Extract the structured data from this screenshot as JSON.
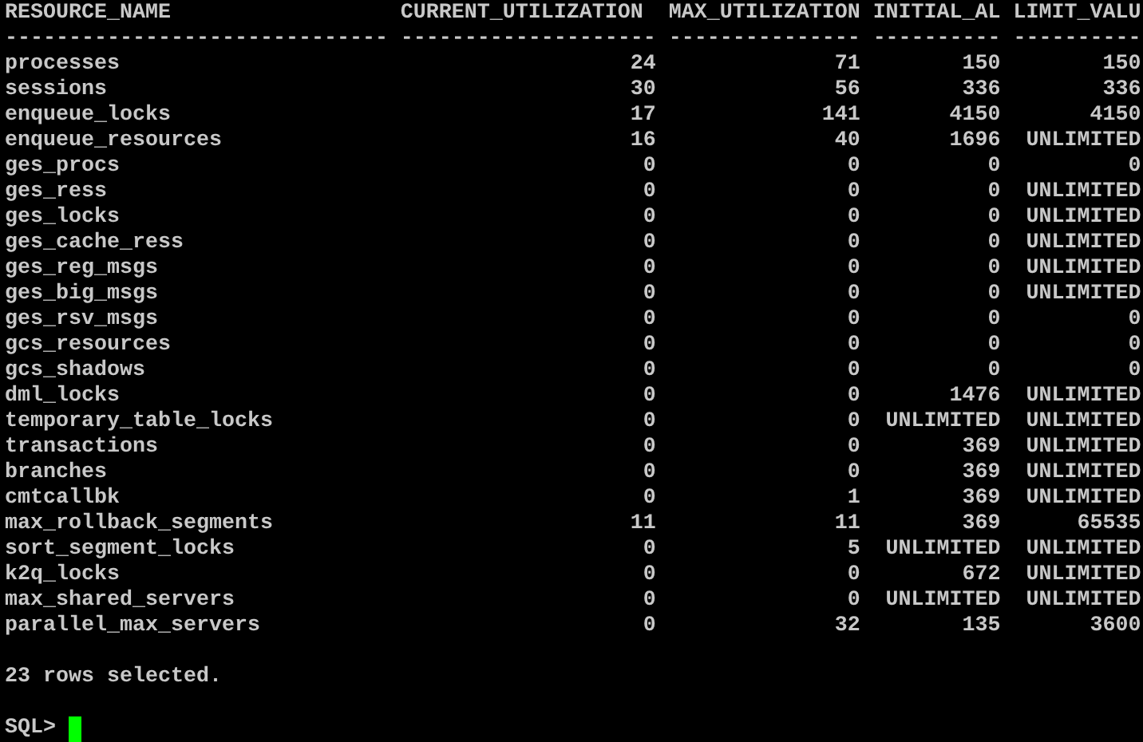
{
  "table": {
    "columns": [
      "RESOURCE_NAME",
      "CURRENT_UTILIZATION",
      "MAX_UTILIZATION",
      "INITIAL_AL",
      "LIMIT_VALU"
    ],
    "separators": [
      "------------------------------",
      "--------------------",
      "---------------",
      "----------",
      "----------"
    ],
    "rows": [
      [
        "processes",
        "24",
        "71",
        "150",
        "150"
      ],
      [
        "sessions",
        "30",
        "56",
        "336",
        "336"
      ],
      [
        "enqueue_locks",
        "17",
        "141",
        "4150",
        "4150"
      ],
      [
        "enqueue_resources",
        "16",
        "40",
        "1696",
        "UNLIMITED"
      ],
      [
        "ges_procs",
        "0",
        "0",
        "0",
        "0"
      ],
      [
        "ges_ress",
        "0",
        "0",
        "0",
        "UNLIMITED"
      ],
      [
        "ges_locks",
        "0",
        "0",
        "0",
        "UNLIMITED"
      ],
      [
        "ges_cache_ress",
        "0",
        "0",
        "0",
        "UNLIMITED"
      ],
      [
        "ges_reg_msgs",
        "0",
        "0",
        "0",
        "UNLIMITED"
      ],
      [
        "ges_big_msgs",
        "0",
        "0",
        "0",
        "UNLIMITED"
      ],
      [
        "ges_rsv_msgs",
        "0",
        "0",
        "0",
        "0"
      ],
      [
        "gcs_resources",
        "0",
        "0",
        "0",
        "0"
      ],
      [
        "gcs_shadows",
        "0",
        "0",
        "0",
        "0"
      ],
      [
        "dml_locks",
        "0",
        "0",
        "1476",
        "UNLIMITED"
      ],
      [
        "temporary_table_locks",
        "0",
        "0",
        "UNLIMITED",
        "UNLIMITED"
      ],
      [
        "transactions",
        "0",
        "0",
        "369",
        "UNLIMITED"
      ],
      [
        "branches",
        "0",
        "0",
        "369",
        "UNLIMITED"
      ],
      [
        "cmtcallbk",
        "0",
        "1",
        "369",
        "UNLIMITED"
      ],
      [
        "max_rollback_segments",
        "11",
        "11",
        "369",
        "65535"
      ],
      [
        "sort_segment_locks",
        "0",
        "5",
        "UNLIMITED",
        "UNLIMITED"
      ],
      [
        "k2q_locks",
        "0",
        "0",
        "672",
        "UNLIMITED"
      ],
      [
        "max_shared_servers",
        "0",
        "0",
        "UNLIMITED",
        "UNLIMITED"
      ],
      [
        "parallel_max_servers",
        "0",
        "32",
        "135",
        "3600"
      ]
    ]
  },
  "status": "23 rows selected.",
  "prompt": "SQL>"
}
